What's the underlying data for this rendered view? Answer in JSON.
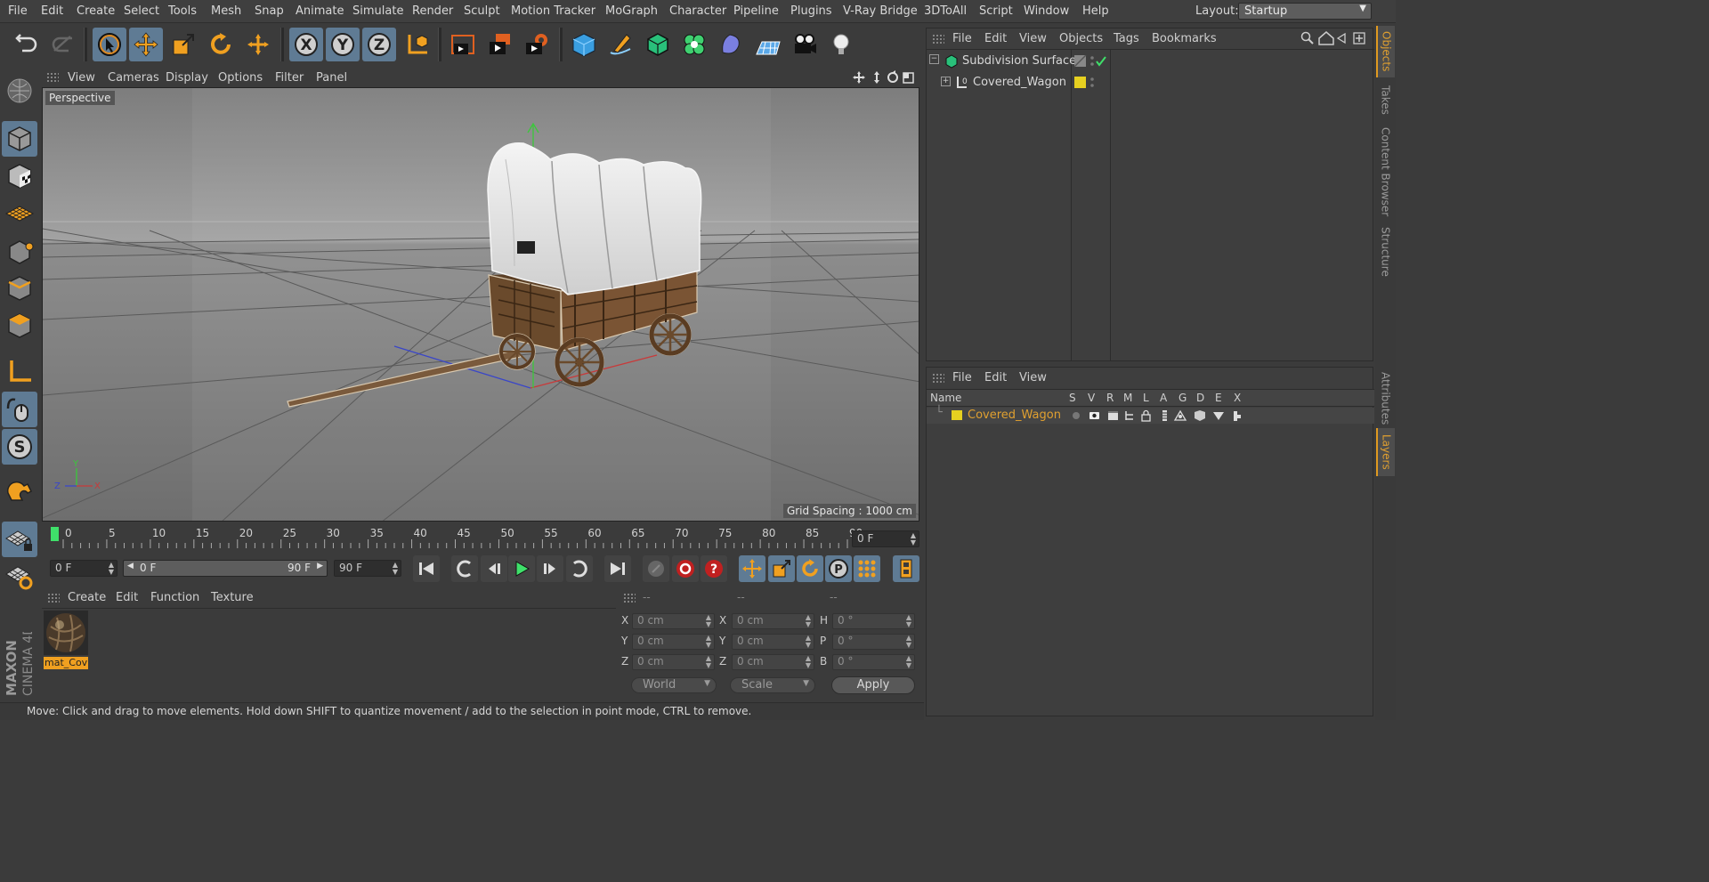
{
  "menubar": {
    "items": [
      "File",
      "Edit",
      "Create",
      "Select",
      "Tools",
      "Mesh",
      "Snap",
      "Animate",
      "Simulate",
      "Render",
      "Sculpt",
      "Motion Tracker",
      "MoGraph",
      "Character",
      "Pipeline",
      "Plugins",
      "V-Ray Bridge",
      "3DToAll",
      "Script",
      "Window",
      "Help"
    ],
    "layout_label": "Layout:",
    "layout_value": "Startup"
  },
  "toolbar": {
    "icons": [
      "undo-icon",
      "redo-icon",
      "live-selection-icon",
      "move-icon",
      "scale-icon",
      "rotate-icon",
      "move-alt-icon",
      "x-axis-icon",
      "y-axis-icon",
      "z-axis-icon",
      "coordinate-system-icon",
      "render-view-icon",
      "render-picture-viewer-icon",
      "render-settings-icon",
      "cube-icon",
      "pen-spline-icon",
      "subdivision-icon",
      "cloner-icon",
      "deformer-icon",
      "floor-icon",
      "camera-icon",
      "light-icon"
    ],
    "axis_labels": [
      "X",
      "Y",
      "Z"
    ]
  },
  "viewport": {
    "menu": [
      "View",
      "Cameras",
      "Display",
      "Options",
      "Filter",
      "Panel"
    ],
    "label": "Perspective",
    "grid_spacing": "Grid Spacing : 1000 cm",
    "axis_x": "X",
    "axis_y": "Y",
    "axis_z": "Z"
  },
  "timeline": {
    "ticks": [
      "0",
      "5",
      "10",
      "15",
      "20",
      "25",
      "30",
      "35",
      "40",
      "45",
      "50",
      "55",
      "60",
      "65",
      "70",
      "75",
      "80",
      "85",
      "90"
    ],
    "current_frame": "0 F",
    "start_field": "0 F",
    "range_start": "0 F",
    "range_end": "90 F",
    "end_field": "90 F"
  },
  "material_panel": {
    "menu": [
      "Create",
      "Edit",
      "Function",
      "Texture"
    ],
    "material_name": "mat_Cov"
  },
  "coords_panel": {
    "headers": [
      "--",
      "--",
      "--"
    ],
    "rows": [
      {
        "l1": "X",
        "v1": "0 cm",
        "l2": "X",
        "v2": "0 cm",
        "l3": "H",
        "v3": "0 °"
      },
      {
        "l1": "Y",
        "v1": "0 cm",
        "l2": "Y",
        "v2": "0 cm",
        "l3": "P",
        "v3": "0 °"
      },
      {
        "l1": "Z",
        "v1": "0 cm",
        "l2": "Z",
        "v2": "0 cm",
        "l3": "B",
        "v3": "0 °"
      }
    ],
    "world": "World",
    "scale": "Scale",
    "apply": "Apply"
  },
  "statusbar": {
    "text": "Move: Click and drag to move elements. Hold down SHIFT to quantize movement / add to the selection in point mode, CTRL to remove."
  },
  "object_manager": {
    "menu": [
      "File",
      "Edit",
      "View",
      "Objects",
      "Tags",
      "Bookmarks"
    ],
    "objects": [
      {
        "name": "Subdivision Surface"
      },
      {
        "name": "Covered_Wagon"
      }
    ]
  },
  "layer_manager": {
    "menu": [
      "File",
      "Edit",
      "View"
    ],
    "columns": [
      "Name",
      "S",
      "V",
      "R",
      "M",
      "L",
      "A",
      "G",
      "D",
      "E",
      "X"
    ],
    "layers": [
      {
        "name": "Covered_Wagon",
        "color": "#e6d020"
      }
    ]
  },
  "side_tabs": {
    "top": [
      "Objects",
      "Takes",
      "Content Browser",
      "Structure"
    ],
    "bottom": [
      "Attributes",
      "Layers"
    ]
  },
  "branding": {
    "line1": "MAXON",
    "line2": "CINEMA 4D"
  },
  "colors": {
    "accent": "#e09a20",
    "selected": "#5f7b94",
    "layer_yellow": "#e6d020"
  }
}
